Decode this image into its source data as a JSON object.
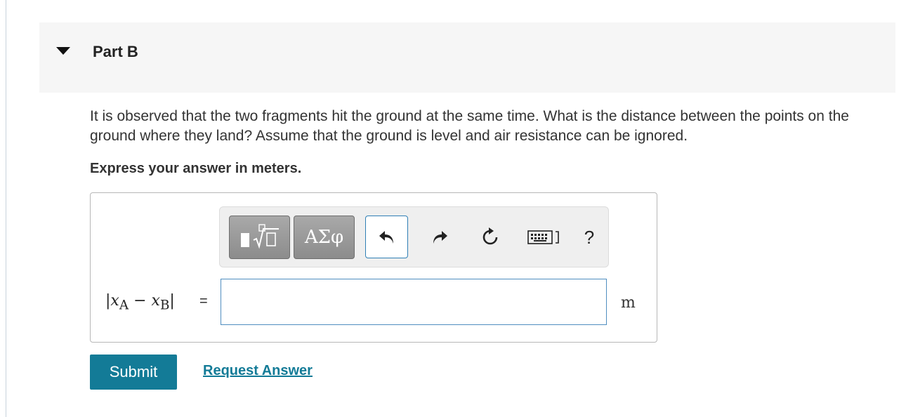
{
  "part": {
    "title": "Part B"
  },
  "question": {
    "text": "It is observed that the two fragments hit the ground at the same time. What is the distance between the points on the ground where they land? Assume that the ground is level and air resistance can be ignored.",
    "instruction": "Express your answer in meters."
  },
  "toolbar": {
    "templates_icon": "templates-sqrt-icon",
    "greek_label": "ΑΣφ",
    "undo_icon": "undo-icon",
    "redo_icon": "redo-icon",
    "reset_icon": "reset-icon",
    "keyboard_icon": "keyboard-icon",
    "help_label": "?"
  },
  "answer": {
    "label_var1": "x",
    "label_sub1": "A",
    "label_minus": "−",
    "label_var2": "x",
    "label_sub2": "B",
    "equals": "=",
    "input_value": "",
    "unit": "m"
  },
  "actions": {
    "submit_label": "Submit",
    "request_answer_label": "Request Answer"
  },
  "colors": {
    "accent": "#137b97",
    "input_border": "#4f8ec0",
    "header_bg": "#f6f6f6"
  }
}
